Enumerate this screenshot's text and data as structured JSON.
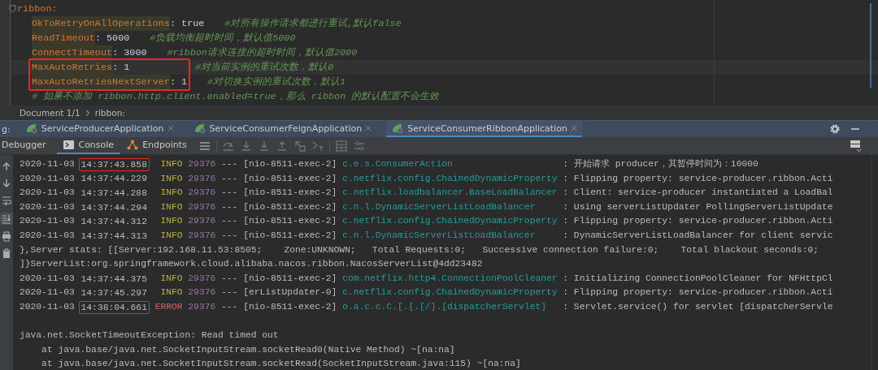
{
  "editor": {
    "lines": [
      {
        "key": "ribbon:",
        "children": [
          {
            "key": "OkToRetryOnAllOperations",
            "value": ": true",
            "comment": "#对所有操作请求都进行重试,默认false",
            "boxed": false,
            "current": false
          },
          {
            "key": "ReadTimeout",
            "value": ": 5000",
            "comment": "#负载均衡超时时间，默认值5000",
            "boxed": false,
            "current": false
          },
          {
            "key": "ConnectTimeout",
            "value": ": 3000",
            "comment": "#ribbon请求连接的超时时间，默认值2000",
            "boxed": false,
            "current": false
          },
          {
            "key": "MaxAutoRetries",
            "value": ": 1",
            "comment": "#对当前实例的重试次数，默认0",
            "boxed": true,
            "current": true
          },
          {
            "key": "MaxAutoRetriesNextServer",
            "value": ": 1",
            "comment": "#对切换实例的重试次数，默认1",
            "boxed": true,
            "current": false
          },
          {
            "comment": "# 如果不添加 ribbon.http.client.enabled=true，那么 ribbon 的默认配置不会生效"
          }
        ]
      }
    ]
  },
  "breadcrumb": [
    "Document 1/1",
    "ribbon:"
  ],
  "run_tabs": {
    "label": "g:",
    "tabs": [
      {
        "label": "ServiceProducerApplication",
        "selected": false
      },
      {
        "label": "ServiceConsumerFeignApplication",
        "selected": false
      },
      {
        "label": "ServiceConsumerRibbonApplication",
        "selected": true
      }
    ]
  },
  "console_tabs": [
    {
      "label": "Debugger",
      "selected": false
    },
    {
      "label": "Console",
      "selected": true
    },
    {
      "label": "Endpoints",
      "selected": false
    }
  ],
  "console": {
    "rows": [
      {
        "kind": "log",
        "date": "2020-11-03",
        "time": "14:37:43.858",
        "boxed": true,
        "level": "INFO",
        "pid": "29376",
        "sep": "---",
        "thread": "[nio-8511-exec-2]",
        "logger": "c.e.s.ConsumerAction",
        "message": ": 开始请求 producer，其暂停时间为：10000"
      },
      {
        "kind": "log",
        "date": "2020-11-03",
        "time": "14:37:44.229",
        "boxed": false,
        "level": "INFO",
        "pid": "29376",
        "sep": "---",
        "thread": "[nio-8511-exec-2]",
        "logger": "c.netflix.config.ChainedDynamicProperty",
        "message": ": Flipping property: service-producer.ribbon.Acti"
      },
      {
        "kind": "log",
        "date": "2020-11-03",
        "time": "14:37:44.288",
        "boxed": false,
        "level": "INFO",
        "pid": "29376",
        "sep": "---",
        "thread": "[nio-8511-exec-2]",
        "logger": "c.netflix.loadbalancer.BaseLoadBalancer",
        "message": ": Client: service-producer instantiated a LoadBal"
      },
      {
        "kind": "log",
        "date": "2020-11-03",
        "time": "14:37:44.294",
        "boxed": false,
        "level": "INFO",
        "pid": "29376",
        "sep": "---",
        "thread": "[nio-8511-exec-2]",
        "logger": "c.n.l.DynamicServerListLoadBalancer",
        "message": ": Using serverListUpdater PollingServerListUpdate"
      },
      {
        "kind": "log",
        "date": "2020-11-03",
        "time": "14:37:44.312",
        "boxed": false,
        "level": "INFO",
        "pid": "29376",
        "sep": "---",
        "thread": "[nio-8511-exec-2]",
        "logger": "c.netflix.config.ChainedDynamicProperty",
        "message": ": Flipping property: service-producer.ribbon.Acti"
      },
      {
        "kind": "log",
        "date": "2020-11-03",
        "time": "14:37:44.313",
        "boxed": false,
        "level": "INFO",
        "pid": "29376",
        "sep": "---",
        "thread": "[nio-8511-exec-2]",
        "logger": "c.n.l.DynamicServerListLoadBalancer",
        "message": ": DynamicServerListLoadBalancer for client servic"
      },
      {
        "kind": "text",
        "text": "},Server stats: [[Server:192.168.11.53:8505;    Zone:UNKNOWN;   Total Requests:0;   Successive connection failure:0;    Total blackout seconds:0;"
      },
      {
        "kind": "text",
        "text": "]}ServerList:org.springframework.cloud.alibaba.nacos.ribbon.NacosServerList@4dd23482"
      },
      {
        "kind": "log",
        "date": "2020-11-03",
        "time": "14:37:44.375",
        "boxed": false,
        "level": "INFO",
        "pid": "29376",
        "sep": "---",
        "thread": "[nio-8511-exec-2]",
        "logger": "com.netflix.http4.ConnectionPoolCleaner",
        "message": ": Initializing ConnectionPoolCleaner for NFHttpCl"
      },
      {
        "kind": "log",
        "date": "2020-11-03",
        "time": "14:37:45.297",
        "boxed": false,
        "level": "INFO",
        "pid": "29376",
        "sep": "---",
        "thread": "[erListUpdater-0]",
        "logger": "c.netflix.config.ChainedDynamicProperty",
        "message": ": Flipping property: service-producer.ribbon.Acti"
      },
      {
        "kind": "log",
        "date": "2020-11-03",
        "time": "14:38:04.661",
        "boxed": true,
        "level": "ERROR",
        "pid": "29376",
        "sep": "---",
        "thread": "[nio-8511-exec-2]",
        "logger": "o.a.c.c.C.[.[.[/].[dispatcherServlet]",
        "message": ": Servlet.service() for servlet [dispatcherServle"
      },
      {
        "kind": "blank"
      },
      {
        "kind": "text",
        "text": "java.net.SocketTimeoutException: Read timed out"
      },
      {
        "kind": "trace",
        "text": "at java.base/java.net.SocketInputStream.socketRead0(Native Method) ~[na:na]"
      },
      {
        "kind": "trace",
        "text": "at java.base/java.net.SocketInputStream.socketRead(SocketInputStream.java:115) ~[na:na]"
      }
    ]
  }
}
